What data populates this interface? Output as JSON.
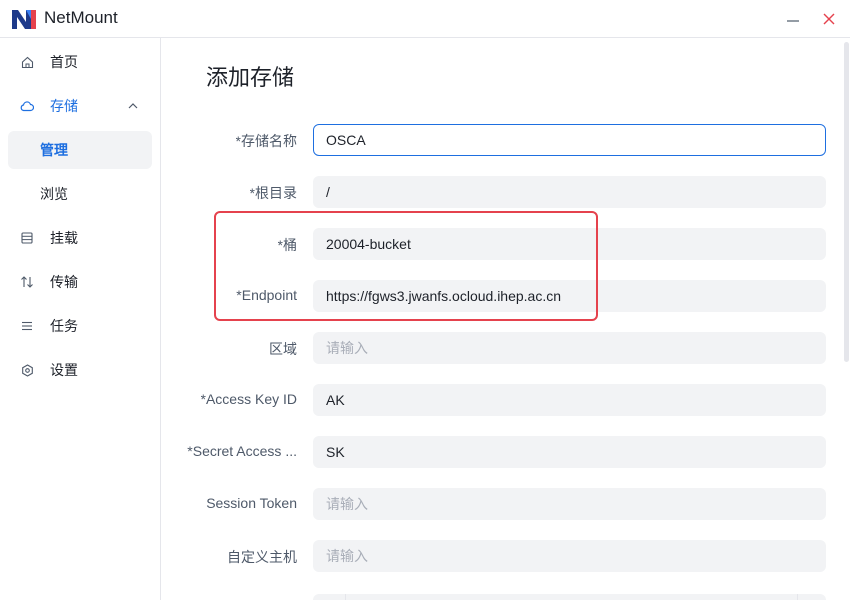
{
  "app": {
    "title": "NetMount"
  },
  "sidebar": {
    "items": [
      {
        "label": "首页",
        "icon": "home-icon"
      },
      {
        "label": "存储",
        "icon": "cloud-icon"
      },
      {
        "label": "管理"
      },
      {
        "label": "浏览"
      },
      {
        "label": "挂载",
        "icon": "drive-icon"
      },
      {
        "label": "传输",
        "icon": "transfer-icon"
      },
      {
        "label": "任务",
        "icon": "list-icon"
      },
      {
        "label": "设置",
        "icon": "gear-icon"
      }
    ]
  },
  "main": {
    "title": "添加存储",
    "fields": [
      {
        "label": "*存储名称",
        "value": "OSCA",
        "placeholder": ""
      },
      {
        "label": "*根目录",
        "value": "/",
        "placeholder": ""
      },
      {
        "label": "*桶",
        "value": "20004-bucket",
        "placeholder": ""
      },
      {
        "label": "*Endpoint",
        "value": "https://fgws3.jwanfs.ocloud.ihep.ac.cn",
        "placeholder": ""
      },
      {
        "label": "区域",
        "value": "",
        "placeholder": "请输入"
      },
      {
        "label": "*Access Key ID",
        "value": "AK",
        "placeholder": ""
      },
      {
        "label": "*Secret Access ...",
        "value": "SK",
        "placeholder": ""
      },
      {
        "label": "Session Token",
        "value": "",
        "placeholder": "请输入"
      },
      {
        "label": "自定义主机",
        "value": "",
        "placeholder": "请输入"
      }
    ]
  },
  "colors": {
    "accent": "#1e6fe0",
    "highlight": "#e5424d",
    "field_bg": "#f2f3f5"
  }
}
